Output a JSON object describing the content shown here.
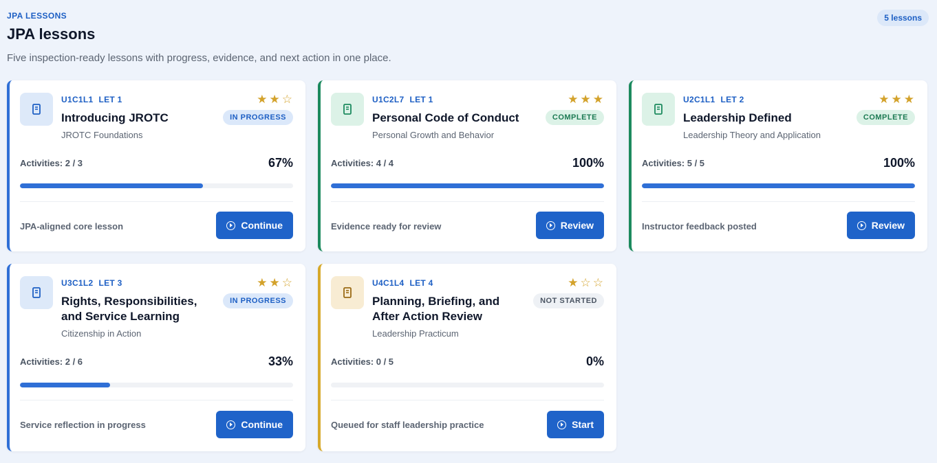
{
  "header": {
    "eyebrow": "JPA LESSONS",
    "title": "JPA lessons",
    "subtitle": "Five inspection-ready lessons with progress, evidence, and next action in one place.",
    "count_badge": "5 lessons"
  },
  "colors": {
    "in_progress_accent": "#2f6fd6",
    "complete_accent": "#1c8a5e",
    "not_started_accent": "#d7a92a",
    "button": "#1f63c9",
    "star": "#d3a22b"
  },
  "lessons": [
    {
      "code": "U1C1L1",
      "let": "LET 1",
      "title": "Introducing JROTC",
      "course": "JROTC Foundations",
      "status": "IN PROGRESS",
      "stars": "★★☆",
      "rating": 2,
      "activities": "Activities: 2 / 3",
      "percent": "67%",
      "progress": 0.67,
      "note": "JPA-aligned core lesson",
      "action": "Continue",
      "icon": "book-icon"
    },
    {
      "code": "U1C2L7",
      "let": "LET 1",
      "title": "Personal Code of Conduct",
      "course": "Personal Growth and Behavior",
      "status": "COMPLETE",
      "stars": "★★★",
      "rating": 3,
      "activities": "Activities: 4 / 4",
      "percent": "100%",
      "progress": 1.0,
      "note": "Evidence ready for review",
      "action": "Review",
      "icon": "book-icon"
    },
    {
      "code": "U2C1L1",
      "let": "LET 2",
      "title": "Leadership Defined",
      "course": "Leadership Theory and Application",
      "status": "COMPLETE",
      "stars": "★★★",
      "rating": 3,
      "activities": "Activities: 5 / 5",
      "percent": "100%",
      "progress": 1.0,
      "note": "Instructor feedback posted",
      "action": "Review",
      "icon": "book-icon"
    },
    {
      "code": "U3C1L2",
      "let": "LET 3",
      "title": "Rights, Responsibilities, and Service Learning",
      "course": "Citizenship in Action",
      "status": "IN PROGRESS",
      "stars": "★★☆",
      "rating": 2,
      "activities": "Activities: 2 / 6",
      "percent": "33%",
      "progress": 0.33,
      "note": "Service reflection in progress",
      "action": "Continue",
      "icon": "book-icon"
    },
    {
      "code": "U4C1L4",
      "let": "LET 4",
      "title": "Planning, Briefing, and After Action Review",
      "course": "Leadership Practicum",
      "status": "NOT STARTED",
      "stars": "★☆☆",
      "rating": 1,
      "activities": "Activities: 0 / 5",
      "percent": "0%",
      "progress": 0.0,
      "note": "Queued for staff leadership practice",
      "action": "Start",
      "icon": "book-icon"
    }
  ]
}
